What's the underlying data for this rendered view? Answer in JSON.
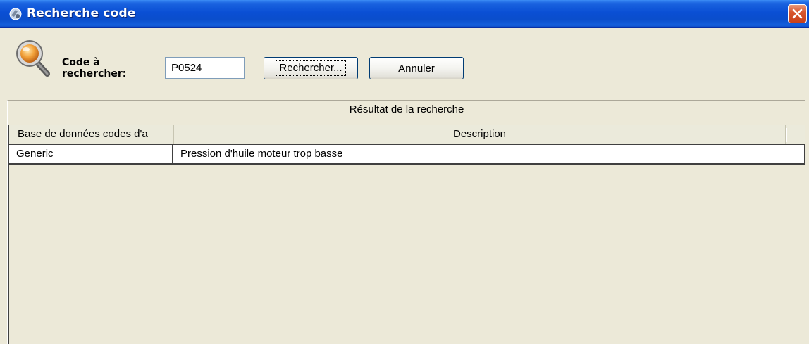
{
  "window": {
    "title": "Recherche code",
    "close_icon": "close-icon",
    "title_icon": "app-icon"
  },
  "search": {
    "icon": "magnifier-icon",
    "label": "Code à rechercher:",
    "label_line1": "Code à",
    "label_line2": "rechercher:",
    "code_value": "P0524",
    "search_button": "Rechercher...",
    "cancel_button": "Annuler"
  },
  "results": {
    "title": "Résultat de la recherche",
    "columns": [
      "Base de données codes d'a",
      "Description"
    ],
    "rows": [
      {
        "database": "Generic",
        "description": "Pression d'huile moteur trop basse"
      }
    ]
  },
  "colors": {
    "titlebar": "#0a4fd4",
    "window_bg": "#ece9d8",
    "close_button": "#d8572f"
  }
}
